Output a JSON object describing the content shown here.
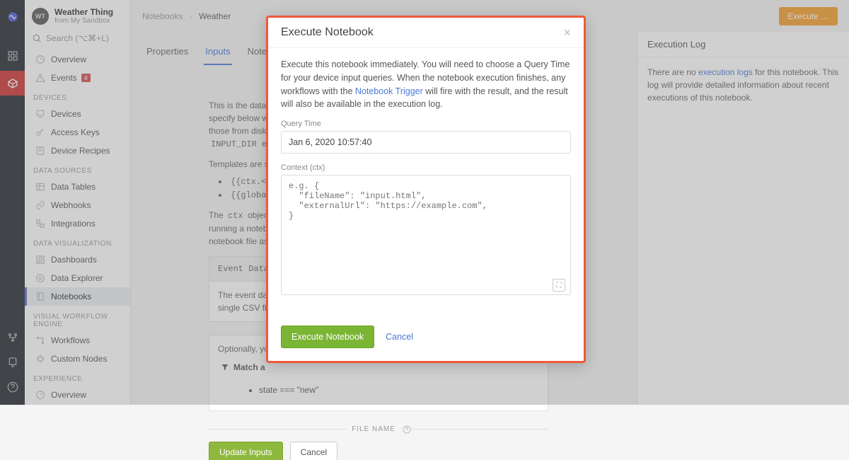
{
  "app": {
    "title": "Weather Thing",
    "subtitle": "from My Sandbox",
    "avatar": "WT"
  },
  "search": {
    "placeholder": "Search (⌥⌘+L)"
  },
  "sidebar": {
    "items_top": [
      {
        "label": "Overview",
        "icon": "gauge"
      },
      {
        "label": "Events",
        "icon": "warning",
        "badge": "4"
      }
    ],
    "sec_devices": "DEVICES",
    "items_devices": [
      {
        "label": "Devices",
        "icon": "device"
      },
      {
        "label": "Access Keys",
        "icon": "key"
      },
      {
        "label": "Device Recipes",
        "icon": "recipe"
      }
    ],
    "sec_data": "DATA SOURCES",
    "items_data": [
      {
        "label": "Data Tables",
        "icon": "table"
      },
      {
        "label": "Webhooks",
        "icon": "link"
      },
      {
        "label": "Integrations",
        "icon": "int"
      }
    ],
    "sec_viz": "DATA VISUALIZATION",
    "items_viz": [
      {
        "label": "Dashboards",
        "icon": "dash"
      },
      {
        "label": "Data Explorer",
        "icon": "explorer"
      },
      {
        "label": "Notebooks",
        "icon": "notebook",
        "active": true
      }
    ],
    "sec_wf": "VISUAL WORKFLOW ENGINE",
    "items_wf": [
      {
        "label": "Workflows",
        "icon": "wf"
      },
      {
        "label": "Custom Nodes",
        "icon": "node"
      }
    ],
    "sec_exp": "EXPERIENCE",
    "items_exp": [
      {
        "label": "Overview",
        "icon": "gauge"
      }
    ]
  },
  "breadcrumb": {
    "a": "Notebooks",
    "b": "Weather"
  },
  "top_button": "Execute …",
  "tabs": [
    {
      "label": "Properties"
    },
    {
      "label": "Inputs",
      "active": true
    },
    {
      "label": "Notebook"
    }
  ],
  "main": {
    "p1a": "This is the data t",
    "p1b": "specify below wi",
    "p1c": "those from disk.",
    "p1d": "INPUT_DIR env",
    "p2": "Templates are su",
    "li1": "{{ctx.<",
    "li2": "{{globa",
    "p3a": "The ",
    "p3code": "ctx",
    "p3b": " object i",
    "p3c": "running a noteb",
    "p3d": "notebook file as",
    "panel_header": "Event Data",
    "panel_body1": "The event dat",
    "panel_body2": "single CSV file",
    "opt": "Optionally, yo",
    "filter_label": "Match a",
    "bullet": "state === \"new\"",
    "fname": "FILE NAME",
    "update": "Update Inputs",
    "cancel": "Cancel"
  },
  "right": {
    "title": "Execution Log",
    "body_a": "There are no ",
    "body_link": "execution logs",
    "body_b": " for this notebook. This log will provide detailed information about recent executions of this notebook."
  },
  "modal": {
    "title": "Execute Notebook",
    "desc_a": "Execute this notebook immediately. You will need to choose a Query Time for your device input queries. When the notebook execution finishes, any workflows with the ",
    "desc_link": "Notebook Trigger",
    "desc_b": " will fire with the result, and the result will also be available in the execution log.",
    "label_qt": "Query Time",
    "qt_value": "Jan 6, 2020 10:57:40",
    "label_ctx": "Context (ctx)",
    "ctx_placeholder": "e.g. {\n  \"fileName\": \"input.html\",\n  \"externalUrl\": \"https://example.com\",\n}",
    "btn_exec": "Execute Notebook",
    "btn_cancel": "Cancel"
  }
}
